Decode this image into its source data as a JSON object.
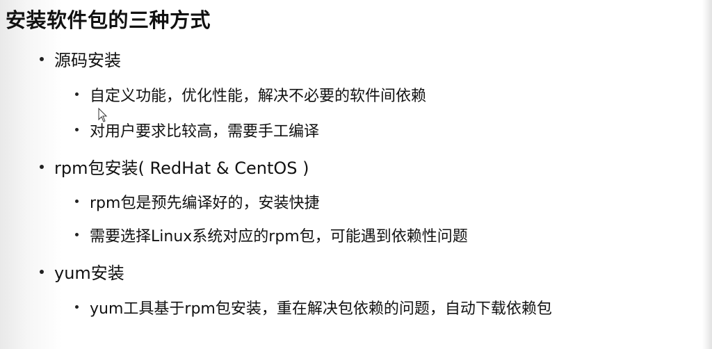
{
  "slide": {
    "title": "安装软件包的三种方式",
    "sections": [
      {
        "heading": "源码安装",
        "points": [
          "自定义功能，优化性能，解决不必要的软件间依赖",
          "对用户要求比较高，需要手工编译"
        ]
      },
      {
        "heading": "rpm包安装( RedHat & CentOS )",
        "points": [
          "rpm包是预先编译好的，安装快捷",
          "需要选择Linux系统对应的rpm包，可能遇到依赖性问题"
        ]
      },
      {
        "heading": "yum安装",
        "points": [
          "yum工具基于rpm包安装，重在解决包依赖的问题，自动下载依赖包"
        ]
      }
    ]
  },
  "icons": {
    "cursor": "mouse-pointer-icon"
  }
}
